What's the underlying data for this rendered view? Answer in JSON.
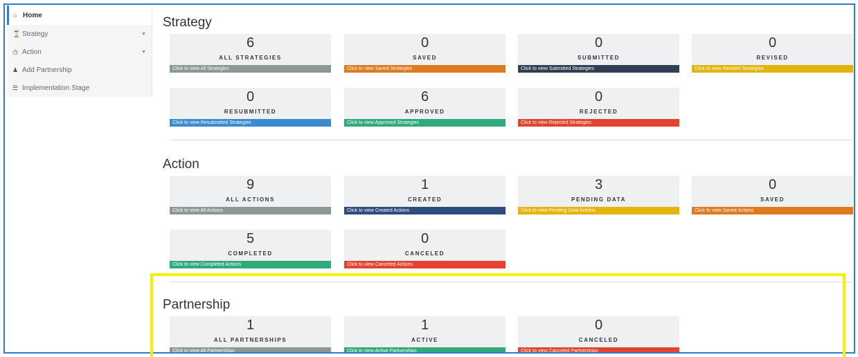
{
  "sidebar": {
    "items": [
      {
        "label": "Home",
        "icon": "home-icon"
      },
      {
        "label": "Strategy",
        "icon": "hourglass-icon"
      },
      {
        "label": "Action",
        "icon": "clock-icon"
      },
      {
        "label": "Add Partnership",
        "icon": "user-icon"
      },
      {
        "label": "Implementation Stage",
        "icon": "list-icon"
      }
    ]
  },
  "strategy": {
    "title": "Strategy",
    "cards": [
      {
        "count": "6",
        "label": "ALL STRATEGIES",
        "link": "Click to view All Strategies",
        "color": "#8c9898"
      },
      {
        "count": "0",
        "label": "SAVED",
        "link": "Click to view Saved Strategies",
        "color": "#e07a20"
      },
      {
        "count": "0",
        "label": "SUBMITTED",
        "link": "Click to view Submitted Strategies",
        "color": "#2f3e52"
      },
      {
        "count": "0",
        "label": "REVISED",
        "link": "Click to view Revised Strategies",
        "color": "#e2b40c"
      },
      {
        "count": "0",
        "label": "RESUBMITTED",
        "link": "Click to view Resubmitted Strategies",
        "color": "#3a8bd0"
      },
      {
        "count": "6",
        "label": "APPROVED",
        "link": "Click to view Approved Strategies",
        "color": "#2faa7a"
      },
      {
        "count": "0",
        "label": "REJECTED",
        "link": "Click to view Rejected Strategies",
        "color": "#e5422f"
      }
    ]
  },
  "action": {
    "title": "Action",
    "cards": [
      {
        "count": "9",
        "label": "ALL ACTIONS",
        "link": "Click to view All Actions",
        "color": "#8c9898"
      },
      {
        "count": "1",
        "label": "CREATED",
        "link": "Click to view Created Actions",
        "color": "#2c4b80"
      },
      {
        "count": "3",
        "label": "PENDING DATA",
        "link": "Click to view Pending Data Actions",
        "color": "#e2b40c"
      },
      {
        "count": "0",
        "label": "SAVED",
        "link": "Click to view Saved Actions",
        "color": "#e07a20"
      },
      {
        "count": "5",
        "label": "COMPLETED",
        "link": "Click to view Completed Actions",
        "color": "#2faa7a"
      },
      {
        "count": "0",
        "label": "CANCELED",
        "link": "Click to view Canceled Actions",
        "color": "#e5422f"
      }
    ]
  },
  "partnership": {
    "title": "Partnership",
    "cards": [
      {
        "count": "1",
        "label": "ALL PARTNERSHIPS",
        "link": "Click to view All Partnerships",
        "color": "#8c9898"
      },
      {
        "count": "1",
        "label": "ACTIVE",
        "link": "Click to view Active Partnerships",
        "color": "#2faa7a"
      },
      {
        "count": "0",
        "label": "CANCELED",
        "link": "Click to view Canceled Partnerships",
        "color": "#e5422f"
      }
    ]
  },
  "highlight_color": "#f5f200"
}
